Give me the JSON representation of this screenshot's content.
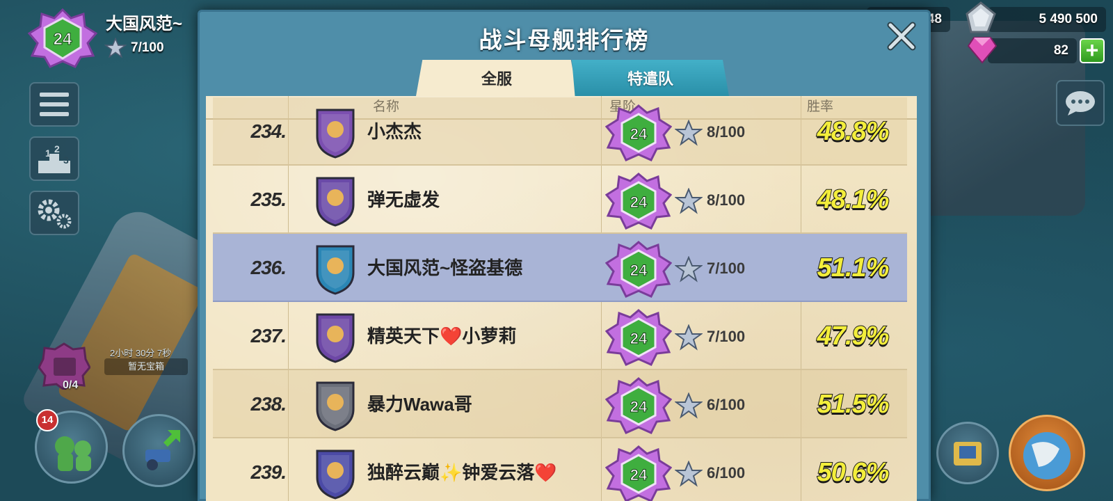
{
  "player": {
    "level": "24",
    "name": "大国风范~",
    "stars": "7/100"
  },
  "resources": {
    "partial_value": "48",
    "iron": "5 490 500",
    "diamonds": "82"
  },
  "chest": {
    "count": "0/4",
    "timer": "2小时 30分 7秒",
    "status": "暂无宝箱"
  },
  "notifications": {
    "count": "14"
  },
  "dialog": {
    "title": "战斗母舰排行榜",
    "tabs": [
      {
        "label": "全服",
        "active": true
      },
      {
        "label": "特遣队",
        "active": false
      }
    ],
    "columns": {
      "name": "名称",
      "rank_tier": "星阶",
      "win_rate": "胜率"
    },
    "rows": [
      {
        "rank": "234.",
        "name": "小杰杰",
        "level": "24",
        "stars": "8/100",
        "win_rate": "48.8%",
        "shield_color": "#7b4fb0",
        "highlight": false
      },
      {
        "rank": "235.",
        "name": "弹无虚发",
        "level": "24",
        "stars": "8/100",
        "win_rate": "48.1%",
        "shield_color": "#6a4aa8",
        "highlight": false
      },
      {
        "rank": "236.",
        "name": "大国风范~怪盗基德",
        "level": "24",
        "stars": "7/100",
        "win_rate": "51.1%",
        "shield_color": "#2a86b5",
        "highlight": true
      },
      {
        "rank": "237.",
        "name": "精英天下❤️小萝莉",
        "level": "24",
        "stars": "7/100",
        "win_rate": "47.9%",
        "shield_color": "#6d47a6",
        "highlight": false
      },
      {
        "rank": "238.",
        "name": "暴力Wawa哥",
        "level": "24",
        "stars": "6/100",
        "win_rate": "51.5%",
        "shield_color": "#6b6f7a",
        "highlight": false
      },
      {
        "rank": "239.",
        "name": "独醉云巅✨钟爱云落❤️",
        "level": "24",
        "stars": "6/100",
        "win_rate": "50.6%",
        "shield_color": "#4b4aa6",
        "highlight": false
      }
    ]
  },
  "colors": {
    "panel_blue": "#4f8ea9",
    "parchment": "#f2e5c4",
    "highlight_row": "#a9b4d6",
    "winrate_yellow": "#f3ee3b",
    "badge_purple": "#b04fcf",
    "badge_green": "#3fae3f"
  }
}
